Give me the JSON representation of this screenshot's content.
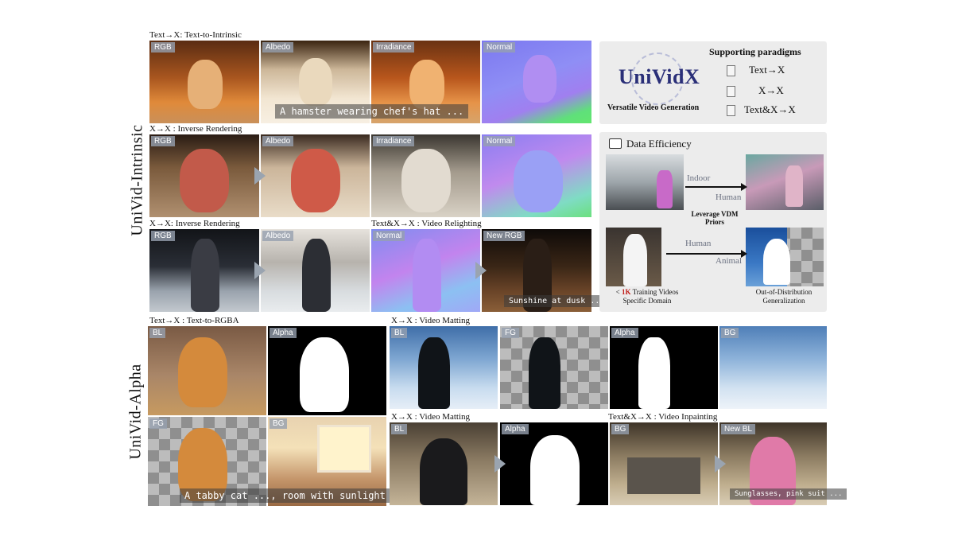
{
  "side_labels": {
    "intrinsic": "UniVid-Intrinsic",
    "alpha": "UniVid-Alpha"
  },
  "captions": {
    "r1": "Text→X: Text-to-Intrinsic",
    "r2": "X→X : Inverse Rendering",
    "r3a": "X→X: Inverse Rendering",
    "r3b": "Text&X→X : Video Relighting",
    "a1": "Text→X : Text-to-RGBA",
    "a2": "X→X : Video Matting",
    "a3": "X→X : Video Matting",
    "a4": "Text&X→X : Video Inpainting"
  },
  "tags": {
    "r1": [
      "RGB",
      "Albedo",
      "Irradiance",
      "Normal"
    ],
    "r2": [
      "RGB",
      "Albedo",
      "Irradiance",
      "Normal"
    ],
    "r3": [
      "RGB",
      "Albedo",
      "Normal",
      "New RGB"
    ],
    "cat": [
      "BL",
      "Alpha",
      "FG",
      "BG"
    ],
    "m1": [
      "BL",
      "FG",
      "Alpha",
      "BG"
    ],
    "m2": [
      "BL",
      "Alpha"
    ],
    "inp": [
      "BG",
      "New BL"
    ]
  },
  "prompts": {
    "hamster": "A hamster wearing chef's hat ...",
    "dusk": "Sunshine at dusk ...",
    "cat": "A tabby cat ..., room with sunlight ...",
    "suit": "Sunglasses, pink suit ..."
  },
  "univid": {
    "logo": "UniVidX",
    "subtitle": "Versatile Video Generation",
    "paradigms_title": "Supporting paradigms",
    "paradigms": [
      "Text→X",
      "X→X",
      "Text&X→X"
    ]
  },
  "efficiency": {
    "title": "Data Efficiency",
    "indoor": "Indoor",
    "human1": "Human",
    "leverage": "Leverage VDM Priors",
    "human2": "Human",
    "animal": "Animal",
    "train_prefix": "< ",
    "train_emph": "1K",
    "train_rest": " Training Videos",
    "train_line2": "Specific Domain",
    "ood_line1": "Out-of-Distribution",
    "ood_line2": "Generalization"
  },
  "colors": {
    "accent_red": "#c0201c",
    "logo_blue": "#2a2f78",
    "box_bg": "#ececec"
  }
}
